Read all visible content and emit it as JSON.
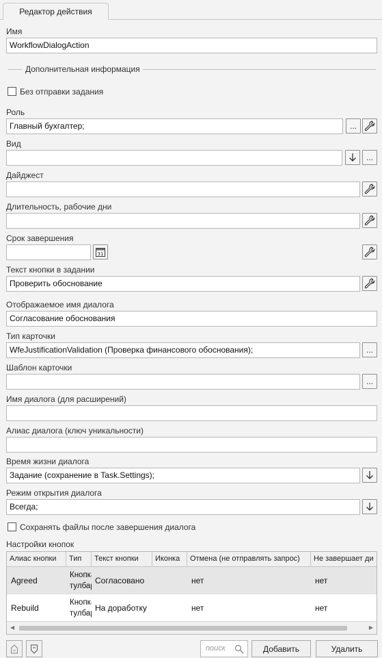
{
  "tab": {
    "title": "Редактор действия"
  },
  "name": {
    "label": "Имя",
    "value": "WorkflowDialogAction"
  },
  "section": {
    "title": "Дополнительная информация"
  },
  "no_task": {
    "label": "Без отправки задания",
    "checked": false
  },
  "role": {
    "label": "Роль",
    "value": "Главный бухгалтер;",
    "browse": "..."
  },
  "kind": {
    "label": "Вид",
    "value": "",
    "browse": "..."
  },
  "digest": {
    "label": "Дайджест",
    "value": ""
  },
  "duration": {
    "label": "Длительность, рабочие дни",
    "value": ""
  },
  "deadline": {
    "label": "Срок завершения",
    "value": "",
    "calendar_day": "31"
  },
  "button_text": {
    "label": "Текст кнопки в задании",
    "value": "Проверить обоснование"
  },
  "dialog_display_name": {
    "label": "Отображаемое имя диалога",
    "value": "Согласование обоснования"
  },
  "card_type": {
    "label": "Тип карточки",
    "value": "WfeJustificationValidation (Проверка финансового обоснования);",
    "browse": "..."
  },
  "card_template": {
    "label": "Шаблон карточки",
    "value": "",
    "browse": "..."
  },
  "dialog_name": {
    "label": "Имя диалога (для расширений)",
    "value": ""
  },
  "dialog_alias": {
    "label": "Алиас диалога (ключ уникальности)",
    "value": ""
  },
  "dialog_lifetime": {
    "label": "Время жизни диалога",
    "value": "Задание (сохранение в Task.Settings);"
  },
  "open_mode": {
    "label": "Режим открытия диалога",
    "value": "Всегда;"
  },
  "keep_files": {
    "label": "Сохранять файлы после завершения диалога",
    "checked": false
  },
  "buttons_settings": {
    "label": "Настройки кнопок",
    "columns": [
      "Алиас кнопки",
      "Тип",
      "Текст кнопки",
      "Иконка",
      "Отмена (не отправлять запрос)",
      "Не завершает ди"
    ],
    "rows": [
      {
        "alias": "Agreed",
        "type": "Кнопка тулбара",
        "text": "Согласовано",
        "icon": "",
        "cancel": "нет",
        "no_finish": "нет"
      },
      {
        "alias": "Rebuild",
        "type": "Кнопка тулбара",
        "text": "На доработку",
        "icon": "",
        "cancel": "нет",
        "no_finish": "нет"
      }
    ]
  },
  "footer": {
    "search_placeholder": "поиск",
    "add_label": "Добавить",
    "delete_label": "Удалить"
  }
}
